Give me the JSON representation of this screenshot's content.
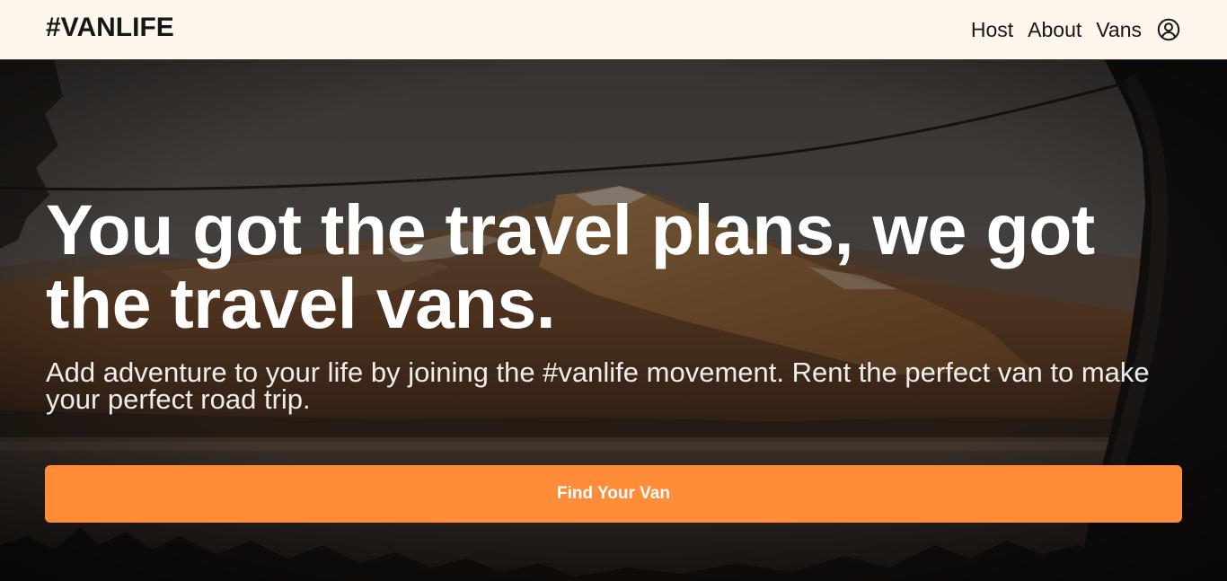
{
  "header": {
    "logo": "#VANLIFE",
    "nav": [
      {
        "label": "Host"
      },
      {
        "label": "About"
      },
      {
        "label": "Vans"
      }
    ],
    "user_icon": "user-circle-icon",
    "background": "#fff7ed"
  },
  "hero": {
    "title": "You got the travel plans, we got the travel vans.",
    "subtitle": "Add adventure to your life by joining the #vanlife movement. Rent the perfect van to make your perfect road trip.",
    "cta_label": "Find Your Van",
    "cta_color": "#ff8c38"
  }
}
